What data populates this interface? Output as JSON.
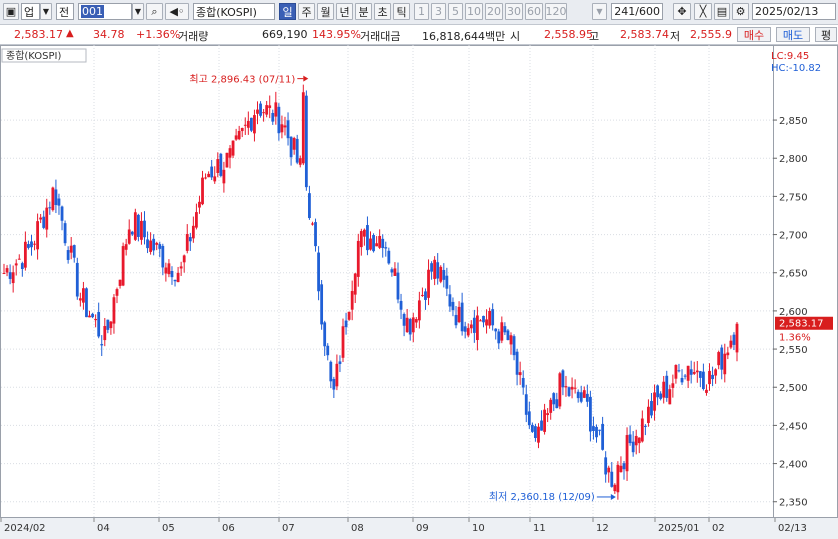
{
  "toolbar": {
    "market": "업",
    "type": "전",
    "code": "001",
    "search_icon": "magnifier-icon",
    "sound_icon": "speaker-icon",
    "name": "종합(KOSPI)",
    "periods": [
      "일",
      "주",
      "월",
      "년",
      "분",
      "초",
      "틱"
    ],
    "selected_period": "일",
    "intervals": [
      "1",
      "3",
      "5",
      "10",
      "20",
      "30",
      "60",
      "120"
    ],
    "count": "241",
    "max": "/600",
    "date": "2025/02/13"
  },
  "quote": {
    "price": "2,583.17",
    "arrow": "▲",
    "change": "34.78",
    "pct": "+1.36%",
    "vol_label": "거래량",
    "volume": "669,190",
    "vol_ratio": "143.95%",
    "amt_label": "거래대금",
    "amount": "16,818,644백만",
    "open_label": "시",
    "open": "2,558.95",
    "high_label": "고",
    "high": "2,583.74",
    "low_label": "저",
    "low": "2,555.9",
    "buy": "매수",
    "sell": "매도",
    "eval": "평"
  },
  "chart_legend": "종합(KOSPI)",
  "lc": "LC:9.45",
  "hc": "HC:-10.82",
  "current_price_label": "2,583.17",
  "current_pct_label": "1.36%",
  "high_annotation": "최고 2,896.43 (07/11)",
  "low_annotation": "최저 2,360.18 (12/09)",
  "colors": {
    "up": "#e8192c",
    "down": "#1f5fd6",
    "grid": "#d9dde3"
  },
  "chart_data": {
    "type": "candlestick",
    "ylim": [
      2330,
      2930
    ],
    "y_ticks": [
      2350,
      2400,
      2450,
      2500,
      2550,
      2600,
      2650,
      2700,
      2750,
      2800,
      2850
    ],
    "y_tick_labels": [
      "2,350",
      "2,400",
      "2,450",
      "2,500",
      "2,550",
      "2,600",
      "2,650",
      "2,700",
      "2,750",
      "2,800",
      "2,850"
    ],
    "x_labels": [
      "2024/02",
      "04",
      "05",
      "06",
      "07",
      "08",
      "09",
      "10",
      "11",
      "12",
      "2025/01",
      "02",
      "02/13"
    ],
    "monthly_path": [
      [
        "2024/02",
        2650
      ],
      [
        "03",
        2680
      ],
      [
        "03",
        2760
      ],
      [
        "04",
        2620
      ],
      [
        "04",
        2560
      ],
      [
        "05",
        2720
      ],
      [
        "05",
        2680
      ],
      [
        "06",
        2650
      ],
      [
        "06",
        2780
      ],
      [
        "07",
        2800
      ],
      [
        "07",
        2870
      ],
      [
        "07",
        2850
      ],
      [
        "08",
        2760
      ],
      [
        "08",
        2480
      ],
      [
        "08",
        2690
      ],
      [
        "09",
        2700
      ],
      [
        "09",
        2580
      ],
      [
        "09",
        2660
      ],
      [
        "10",
        2590
      ],
      [
        "10",
        2590
      ],
      [
        "11",
        2560
      ],
      [
        "11",
        2420
      ],
      [
        "11",
        2500
      ],
      [
        "12",
        2480
      ],
      [
        "12",
        2380
      ],
      [
        "12",
        2440
      ],
      [
        "2025/01",
        2490
      ],
      [
        "2025/01",
        2530
      ],
      [
        "02",
        2510
      ],
      [
        "02/13",
        2583
      ]
    ],
    "high": {
      "date": "07/11",
      "value": 2896.43
    },
    "low": {
      "date": "12/09",
      "value": 2360.18
    },
    "last": {
      "date": "2025/02/13",
      "value": 2583.17,
      "change_pct": 1.36
    }
  }
}
